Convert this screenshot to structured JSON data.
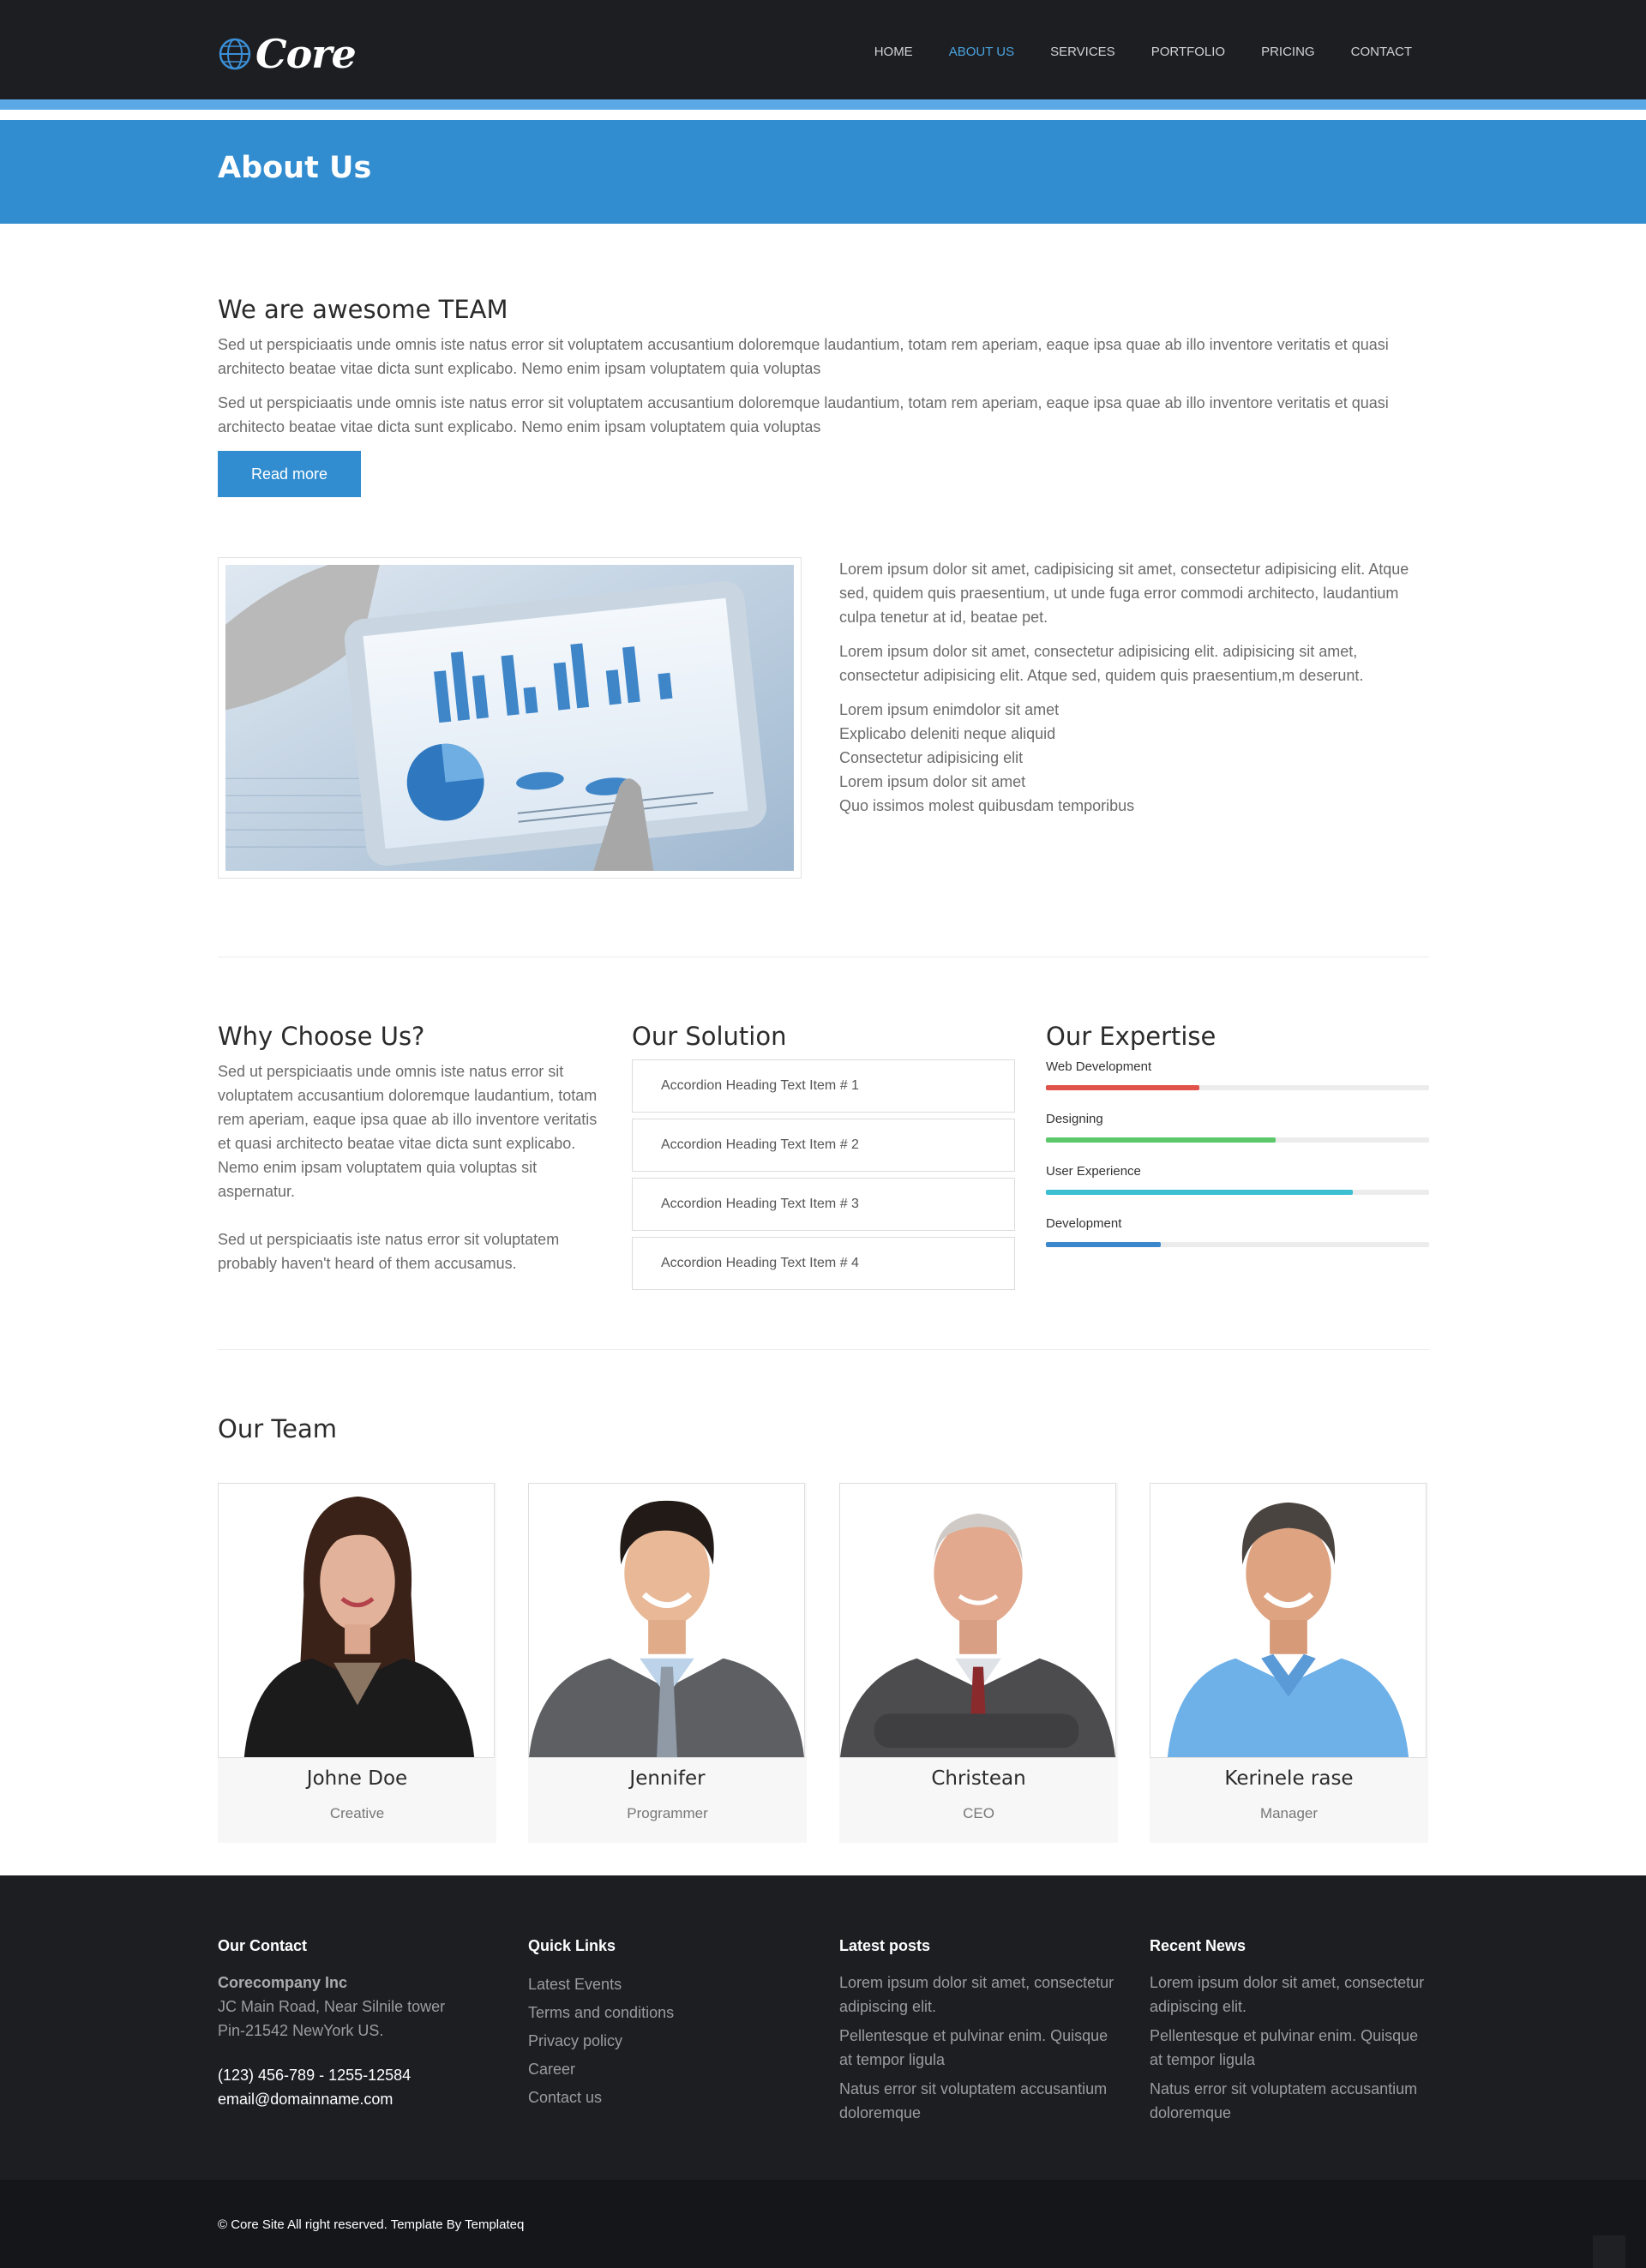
{
  "brand": {
    "name": "Core"
  },
  "nav": {
    "items": [
      {
        "label": "HOME"
      },
      {
        "label": "ABOUT US"
      },
      {
        "label": "SERVICES"
      },
      {
        "label": "PORTFOLIO"
      },
      {
        "label": "PRICING"
      },
      {
        "label": "CONTACT"
      }
    ],
    "active": "ABOUT US"
  },
  "page_title": "About Us",
  "intro": {
    "heading": "We are awesome TEAM",
    "paragraphs": [
      "Sed ut perspiciaatis unde omnis iste natus error sit voluptatem accusantium doloremque laudantium, totam rem aperiam, eaque ipsa quae ab illo inventore veritatis et quasi architecto beatae vitae dicta sunt explicabo. Nemo enim ipsam voluptatem quia voluptas",
      "Sed ut perspiciaatis unde omnis iste natus error sit voluptatem accusantium doloremque laudantium, totam rem aperiam, eaque ipsa quae ab illo inventore veritatis et quasi architecto beatae vitae dicta sunt explicabo. Nemo enim ipsam voluptatem quia voluptas"
    ],
    "button": "Read more"
  },
  "feature": {
    "image_icon": "tablet-chart-image",
    "paragraphs": [
      "Lorem ipsum dolor sit amet, cadipisicing sit amet, consectetur adipisicing elit. Atque sed, quidem quis praesentium, ut unde fuga error commodi architecto, laudantium culpa tenetur at id, beatae pet.",
      "Lorem ipsum dolor sit amet, consectetur adipisicing elit. adipisicing sit amet, consectetur adipisicing elit. Atque sed, quidem quis praesentium,m deserunt."
    ],
    "list": [
      "Lorem ipsum enimdolor sit amet",
      "Explicabo deleniti neque aliquid",
      "Consectetur adipisicing elit",
      "Lorem ipsum dolor sit amet",
      "Quo issimos molest quibusdam temporibus"
    ]
  },
  "why": {
    "heading": "Why Choose Us?",
    "paragraphs": [
      "Sed ut perspiciaatis unde omnis iste natus error sit voluptatem accusantium doloremque laudantium, totam rem aperiam, eaque ipsa quae ab illo inventore veritatis et quasi architecto beatae vitae dicta sunt explicabo. Nemo enim ipsam voluptatem quia voluptas sit aspernatur.",
      "Sed ut perspiciaatis iste natus error sit voluptatem probably haven't heard of them accusamus."
    ]
  },
  "solution": {
    "heading": "Our Solution",
    "items": [
      "Accordion Heading Text Item # 1",
      "Accordion Heading Text Item # 2",
      "Accordion Heading Text Item # 3",
      "Accordion Heading Text Item # 4"
    ]
  },
  "expertise": {
    "heading": "Our Expertise",
    "skills": [
      {
        "label": "Web Development",
        "level": 0.4,
        "color": "#e0524a"
      },
      {
        "label": "Designing",
        "level": 0.6,
        "color": "#5dc86a"
      },
      {
        "label": "User Experience",
        "level": 0.8,
        "color": "#3dbfd2"
      },
      {
        "label": "Development",
        "level": 0.3,
        "color": "#3b87cc"
      }
    ]
  },
  "team": {
    "heading": "Our Team",
    "members": [
      {
        "name": "Johne Doe",
        "role": "Creative",
        "photo": "woman-portrait-photo"
      },
      {
        "name": "Jennifer",
        "role": "Programmer",
        "photo": "young-man-portrait-photo"
      },
      {
        "name": "Christean",
        "role": "CEO",
        "photo": "senior-man-portrait-photo"
      },
      {
        "name": "Kerinele rase",
        "role": "Manager",
        "photo": "man-blue-shirt-portrait-photo"
      }
    ]
  },
  "footer": {
    "contact": {
      "heading": "Our Contact",
      "company": "Corecompany Inc",
      "address1": "JC Main Road, Near Silnile tower",
      "address2": "Pin-21542 NewYork US.",
      "phone": "(123) 456-789 - 1255-12584",
      "email": "email@domainname.com"
    },
    "quick_links": {
      "heading": "Quick Links",
      "items": [
        "Latest Events",
        "Terms and conditions",
        "Privacy policy",
        "Career",
        "Contact us"
      ]
    },
    "latest_posts": {
      "heading": "Latest posts",
      "items": [
        "Lorem ipsum dolor sit amet, consectetur adipiscing elit.",
        "Pellentesque et pulvinar enim. Quisque at tempor ligula",
        "Natus error sit voluptatem accusantium doloremque"
      ]
    },
    "recent_news": {
      "heading": "Recent News",
      "items": [
        "Lorem ipsum dolor sit amet, consectetur adipiscing elit.",
        "Pellentesque et pulvinar enim. Quisque at tempor ligula",
        "Natus error sit voluptatem accusantium doloremque"
      ]
    },
    "copyright": "© Core Site All right reserved. Template By Templateq"
  },
  "colors": {
    "header_bg": "#1d1e22",
    "accent": "#318dd0",
    "nav_active": "#4aa3df"
  }
}
